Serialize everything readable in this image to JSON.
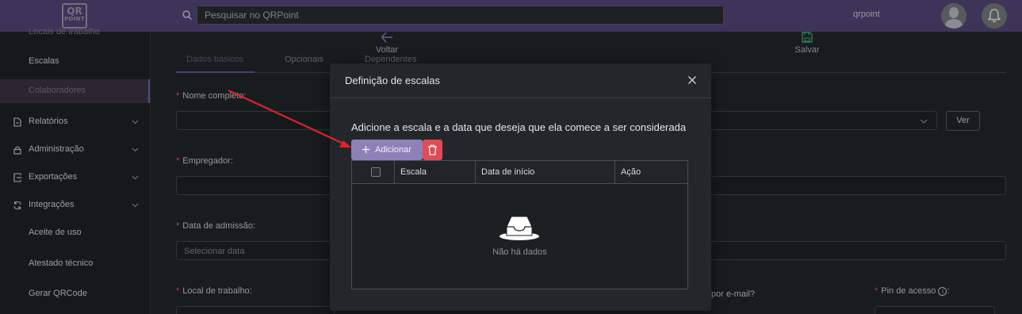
{
  "topbar": {
    "logo_text": "QR",
    "logo_sub": "POINT",
    "search_placeholder": "Pesquisar no QRPoint",
    "username": "qrpoint",
    "icons": [
      "search-icon",
      "avatar-icon",
      "bell-icon"
    ]
  },
  "sidebar": {
    "items": [
      {
        "label": "Locais de trabalho",
        "icon": "",
        "chevron": false,
        "state": "faded"
      },
      {
        "label": "Escalas",
        "icon": "",
        "chevron": false,
        "state": "normal"
      },
      {
        "label": "Colaboradores",
        "icon": "",
        "chevron": false,
        "state": "active"
      },
      {
        "label": "Relatórios",
        "icon": "file-icon",
        "chevron": true,
        "state": "normal"
      },
      {
        "label": "Administração",
        "icon": "lock-icon",
        "chevron": true,
        "state": "normal"
      },
      {
        "label": "Exportações",
        "icon": "export-icon",
        "chevron": true,
        "state": "normal"
      },
      {
        "label": "Integrações",
        "icon": "sync-icon",
        "chevron": true,
        "state": "normal"
      },
      {
        "label": "Aceite de uso",
        "icon": "",
        "chevron": false,
        "state": "normal"
      },
      {
        "label": "Atestado técnico",
        "icon": "",
        "chevron": false,
        "state": "normal"
      },
      {
        "label": "Gerar QRCode",
        "icon": "",
        "chevron": false,
        "state": "normal"
      }
    ]
  },
  "toolbar": {
    "back_label": "Voltar",
    "save_label": "Salvar"
  },
  "tabs": [
    "Dados básicos",
    "Opcionais",
    "Dependentes"
  ],
  "form": {
    "nome_label": "Nome completo",
    "empregador_label": "Empregador",
    "admissao_label": "Data de admissão",
    "admissao_placeholder": "Selecionar data",
    "local_label": "Local de trabalho",
    "email_label": "por e-mail?",
    "pin_label": "Pin de acesso",
    "ver_button": "Ver",
    "required_mark": "*",
    "label_suffix": ":"
  },
  "modal": {
    "title": "Definição de escalas",
    "description": "Adicione a escala e a data que deseja que ela comece a ser considerada",
    "add_button": "Adicionar",
    "table": {
      "columns": [
        "Escala",
        "Data de início",
        "Ação"
      ],
      "rows": [],
      "empty_text": "Não há dados"
    }
  },
  "colors": {
    "topbar": "#4c3f6d",
    "primary_button": "#8c82b8",
    "danger_button": "#e04b55",
    "annotation_arrow": "#e0212b"
  }
}
